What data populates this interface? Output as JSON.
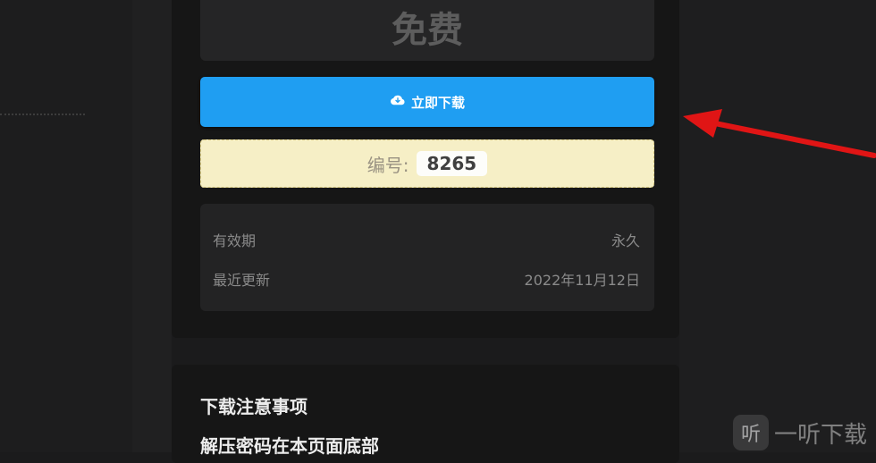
{
  "product": {
    "price_label": "免费",
    "download_button_label": "立即下载",
    "download_icon": "cloud-download-icon",
    "button_color": "#1f9ef2"
  },
  "code": {
    "label": "编号:",
    "value": "8265"
  },
  "info": {
    "validity_label": "有效期",
    "validity_value": "永久",
    "updated_label": "最近更新",
    "updated_value": "2022年11月12日"
  },
  "notes": {
    "title": "下载注意事项",
    "line1": "解压密码在本页面底部"
  },
  "annotation": {
    "arrow_color": "#e01515"
  },
  "watermark": {
    "logo_text": "听",
    "text": "一听下载"
  }
}
